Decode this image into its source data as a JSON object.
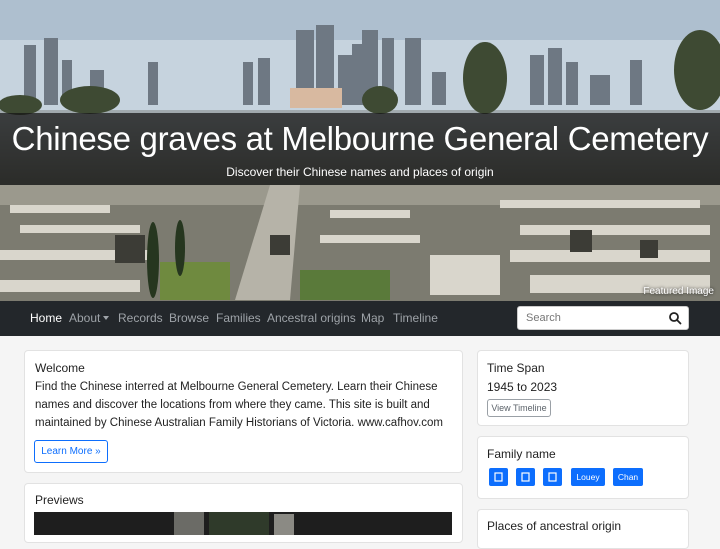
{
  "hero": {
    "title": "Chinese graves at Melbourne General Cemetery",
    "subtitle": "Discover their Chinese names and places of origin",
    "caption": "Featured Image"
  },
  "nav": {
    "items": [
      "Home",
      "About",
      "Records",
      "Browse",
      "Families",
      "Ancestral origins",
      "Map",
      "Timeline"
    ],
    "active": "Home"
  },
  "search": {
    "placeholder": "Search"
  },
  "welcome": {
    "heading": "Welcome",
    "body": "Find the Chinese interred at Melbourne General Cemetery. Learn their Chinese names and discover the locations from where they came. This site is built and maintained by Chinese Australian Family Historians of Victoria. www.cafhov.com",
    "button": "Learn More »"
  },
  "previews": {
    "heading": "Previews"
  },
  "time_span": {
    "heading": "Time Span",
    "range": "1945 to 2023",
    "button": "View Timeline"
  },
  "family_name": {
    "heading": "Family name",
    "tags": [
      "",
      "",
      "",
      "Louey",
      "Chan"
    ]
  },
  "places": {
    "heading": "Places of ancestral origin"
  },
  "colors": {
    "accent": "#0d6efd",
    "navbar": "#23272b"
  },
  "icons": {
    "search": "search-icon"
  }
}
